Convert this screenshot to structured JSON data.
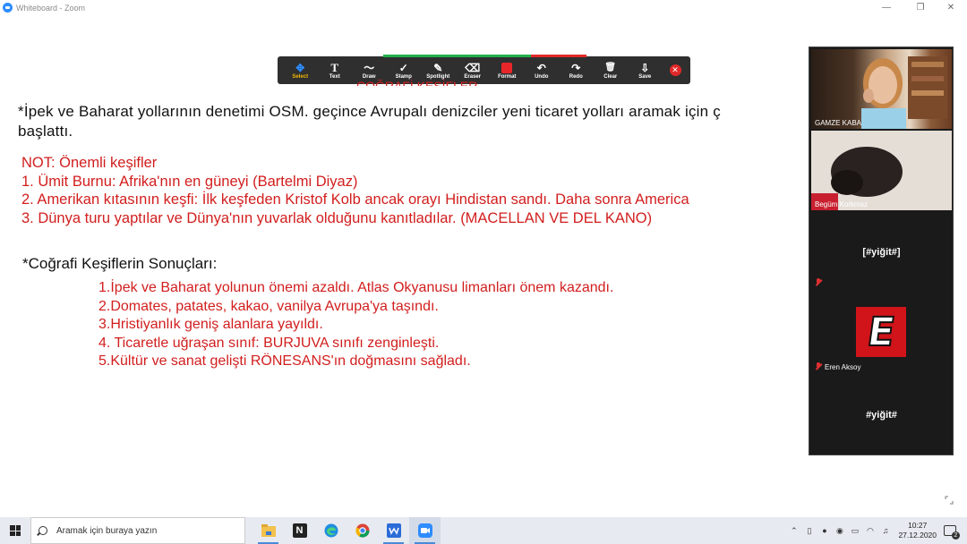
{
  "window": {
    "title": "Whiteboard - Zoom",
    "minimize": "—",
    "restore": "❐",
    "close": "✕"
  },
  "toolbar": {
    "tools": [
      {
        "label": "Select",
        "icon": "✥"
      },
      {
        "label": "Text",
        "icon": "T"
      },
      {
        "label": "Draw",
        "icon": "〜"
      },
      {
        "label": "Stamp",
        "icon": "✓"
      },
      {
        "label": "Spotlight",
        "icon": "✎"
      },
      {
        "label": "Eraser",
        "icon": "⌫"
      },
      {
        "label": "Format",
        "icon": ""
      },
      {
        "label": "Undo",
        "icon": "↶"
      },
      {
        "label": "Redo",
        "icon": "↷"
      },
      {
        "label": "Clear",
        "icon": "🗑"
      },
      {
        "label": "Save",
        "icon": "⇩"
      }
    ],
    "close_icon": "✕",
    "accent_green": "#22b14c",
    "accent_red": "#e02828",
    "format_color": "#e8262a"
  },
  "whiteboard": {
    "hidden_title": "COĞRAFİ KEŞİFLER",
    "intro": [
      "*İpek ve Baharat yollarının denetimi OSM. geçince Avrupalı denizciler yeni ticaret yolları aramak için ç",
      "başlattı."
    ],
    "note_lines": [
      "NOT: Önemli keşifler",
      "1. Ümit Burnu: Afrika'nın en güneyi (Bartelmi Diyaz)",
      "2. Amerikan kıtasının keşfi: İlk keşfeden Kristof Kolb ancak orayı Hindistan sandı. Daha sonra America",
      "3. Dünya turu yaptılar ve Dünya'nın yuvarlak olduğunu kanıtladılar. (MACELLAN VE DEL KANO)"
    ],
    "results_heading": "*Coğrafi Keşiflerin Sonuçları:",
    "results": [
      "1.İpek ve Baharat yolunun önemi azaldı. Atlas Okyanusu limanları önem kazandı.",
      "2.Domates, patates, kakao, vanilya Avrupa'ya taşındı.",
      "3.Hristiyanlık geniş alanlara yayıldı.",
      "4. Ticaretle uğraşan sınıf: BURJUVA sınıfı zenginleşti.",
      "5.Kültür ve sanat gelişti RÖNESANS'ın doğmasını sağladı."
    ]
  },
  "participants": {
    "p1_name": "GAMZE KABA",
    "p2_name": "Begüm Korkmaz",
    "p3_display": "[#yiğit#]",
    "p4_name": "Eren Aksoy",
    "p4_logo": "E",
    "p5_display": "#yiğit#"
  },
  "taskbar": {
    "search_placeholder": "Aramak için buraya yazın",
    "apps": [
      "file-explorer",
      "notion",
      "edge",
      "chrome",
      "whiteboard-app",
      "zoom"
    ],
    "notion_glyph": "N",
    "time": "10:27",
    "date": "27.12.2020",
    "notifications": "2",
    "tray_icons": [
      "chevron-up",
      "usb",
      "microphone",
      "camera",
      "battery",
      "wifi",
      "volume"
    ]
  }
}
